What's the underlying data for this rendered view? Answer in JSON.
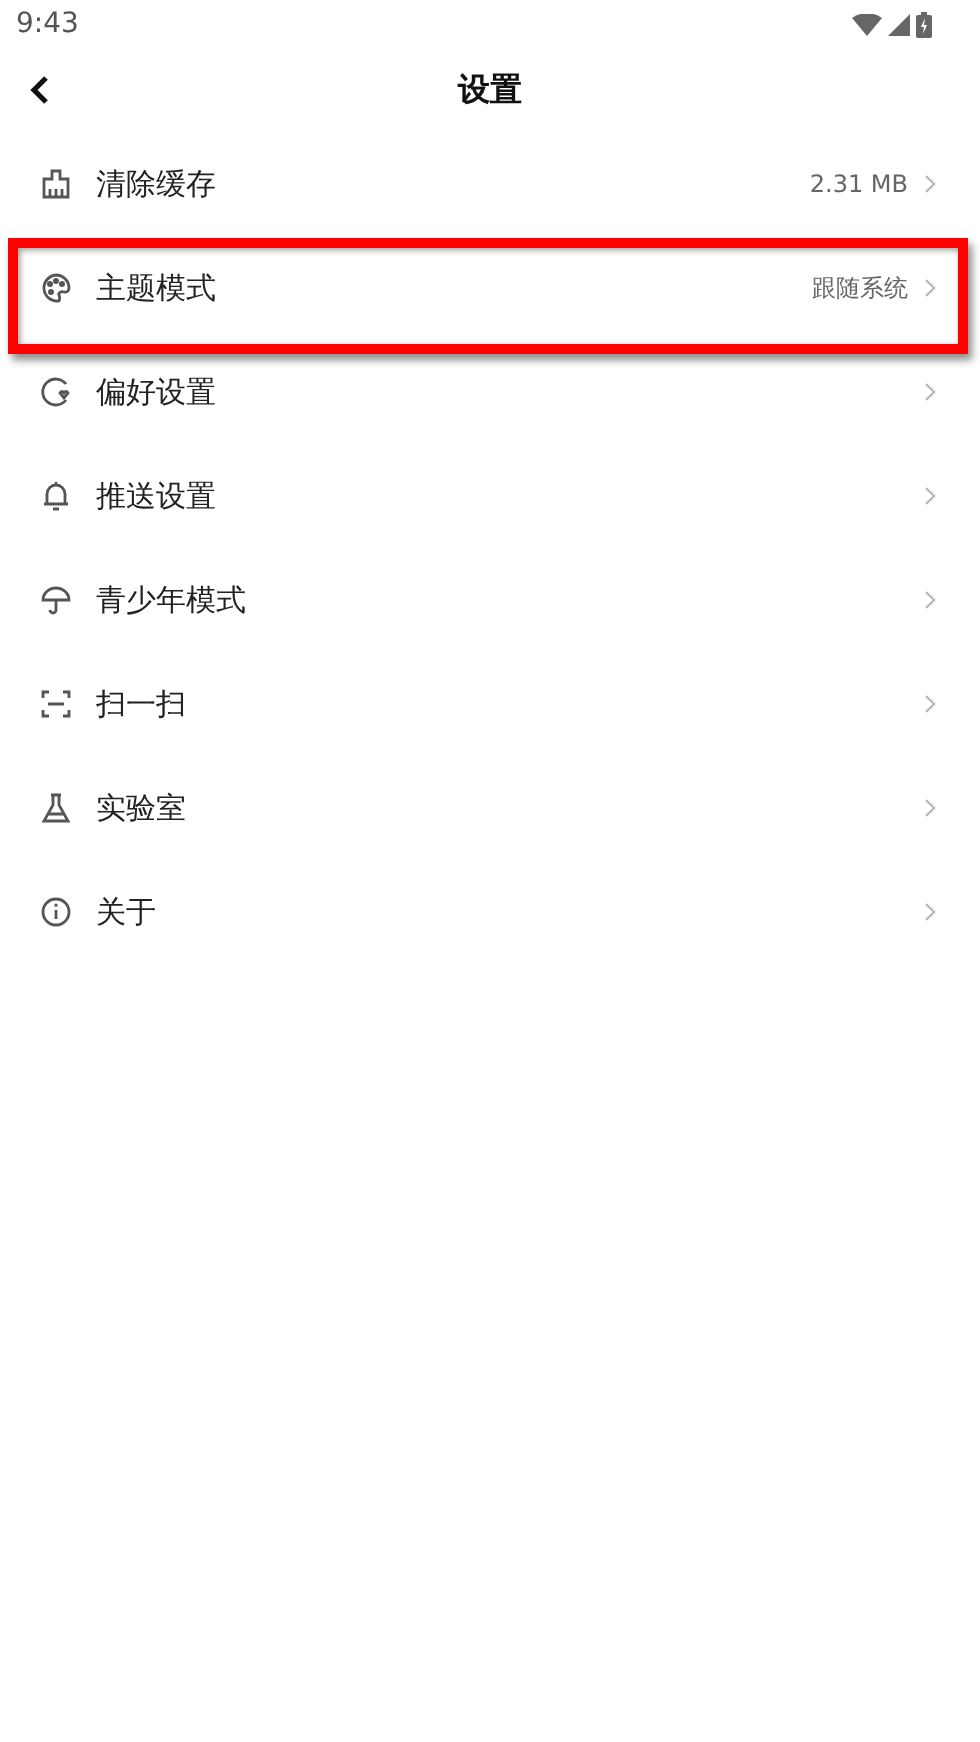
{
  "status_bar": {
    "time": "9:43"
  },
  "header": {
    "title": "设置"
  },
  "items": [
    {
      "label": "清除缓存",
      "value": "2.31 MB",
      "highlighted": false
    },
    {
      "label": "主题模式",
      "value": "跟随系统",
      "highlighted": true
    },
    {
      "label": "偏好设置",
      "highlighted": false
    },
    {
      "label": "推送设置",
      "highlighted": false
    },
    {
      "label": "青少年模式",
      "highlighted": false
    },
    {
      "label": "扫一扫",
      "highlighted": false
    },
    {
      "label": "实验室",
      "highlighted": false
    },
    {
      "label": "关于",
      "highlighted": false
    }
  ]
}
